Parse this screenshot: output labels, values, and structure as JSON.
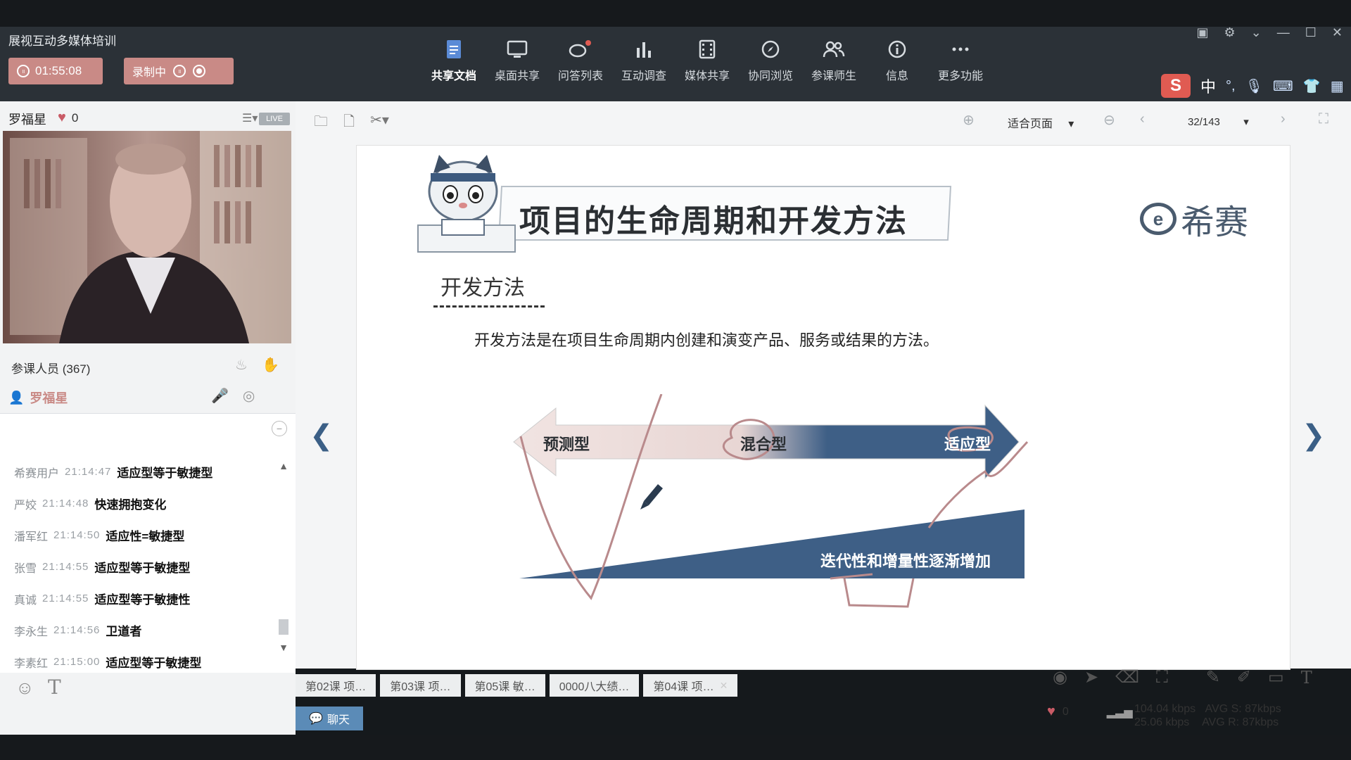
{
  "app": {
    "title": "展视互动多媒体培训",
    "timer": "01:55:08",
    "record_label": "录制中"
  },
  "toolbar": {
    "items": [
      {
        "label": "共享文档",
        "icon": "document-share-icon",
        "active": true
      },
      {
        "label": "桌面共享",
        "icon": "desktop-share-icon"
      },
      {
        "label": "问答列表",
        "icon": "qa-list-icon"
      },
      {
        "label": "互动调查",
        "icon": "bar-chart-icon"
      },
      {
        "label": "媒体共享",
        "icon": "film-icon"
      },
      {
        "label": "协同浏览",
        "icon": "compass-icon"
      },
      {
        "label": "参课师生",
        "icon": "users-icon"
      },
      {
        "label": "信息",
        "icon": "info-icon"
      },
      {
        "label": "更多功能",
        "icon": "more-icon"
      }
    ]
  },
  "ime": {
    "lang": "中"
  },
  "left": {
    "speaker": "罗福星",
    "likes": "0",
    "live_badge": "LIVE",
    "participants_label": "参课人员 (367)",
    "me_name": "罗福星"
  },
  "chat": {
    "messages": [
      {
        "user": "希赛用户",
        "time": "21:14:47",
        "text": "适应型等于敏捷型"
      },
      {
        "user": "严姣",
        "time": "21:14:48",
        "text": "快速拥抱变化"
      },
      {
        "user": "潘军红",
        "time": "21:14:50",
        "text": "适应性=敏捷型"
      },
      {
        "user": "张雪",
        "time": "21:14:55",
        "text": "适应型等于敏捷型"
      },
      {
        "user": "真诚",
        "time": "21:14:55",
        "text": "适应型等于敏捷性"
      },
      {
        "user": "李永生",
        "time": "21:14:56",
        "text": "卫道者"
      },
      {
        "user": "李素红",
        "time": "21:15:00",
        "text": "适应型等于敏捷型"
      }
    ],
    "tab_label": "聊天"
  },
  "docbar": {
    "zoom": "适合页面",
    "page": "32/143"
  },
  "slide": {
    "title": "项目的生命周期和开发方法",
    "brand": "希赛",
    "subtitle": "开发方法",
    "definition": "开发方法是在项目生命周期内创建和演变产品、服务或结果的方法。",
    "arrow_labels": [
      "预测型",
      "混合型",
      "适应型"
    ],
    "wedge_label": "迭代性和增量性逐渐增加"
  },
  "doc_tabs": [
    "第02课 项…",
    "第03课 项…",
    "第05课 敏…",
    "0000八大绩…",
    "第04课 项…"
  ],
  "status": {
    "likes": "0",
    "up_rate": "104.04 kbps",
    "down_rate": "25.06 kbps",
    "avg_s": "AVG S: 87kbps",
    "avg_r": "AVG R: 87kbps"
  },
  "colors": {
    "titlebar": "#2b3137",
    "record_button": "#c98a86",
    "slide_blue": "#3e5f86",
    "annotation": "#b98a8c",
    "chat_tab": "#5b8bb7"
  }
}
